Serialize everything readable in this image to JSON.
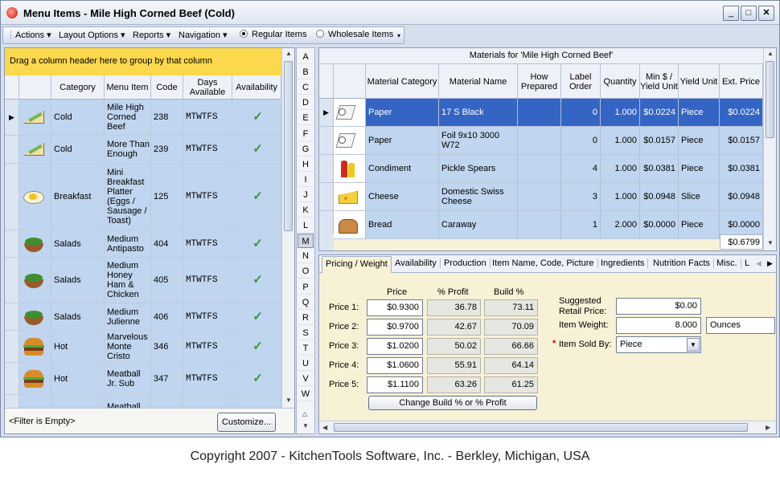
{
  "window": {
    "title": "Menu Items - Mile High Corned Beef (Cold)"
  },
  "toolbar": {
    "menus": [
      "Actions",
      "Layout Options",
      "Reports",
      "Navigation"
    ],
    "radio_regular": "Regular Items",
    "radio_wholesale": "Wholesale Items",
    "selected": "Regular Items"
  },
  "left": {
    "group_hint": "Drag a column header here to group by that column",
    "columns": [
      "Category",
      "Menu Item",
      "Code",
      "Days Available",
      "Availability"
    ],
    "rows": [
      {
        "icon": "sandwich-icon",
        "category": "Cold",
        "item": "Mile High Corned Beef",
        "code": "238",
        "days": "MTWTFS",
        "available": true
      },
      {
        "icon": "sandwich-icon",
        "category": "Cold",
        "item": "More Than Enough",
        "code": "239",
        "days": "MTWTFS",
        "available": true
      },
      {
        "icon": "egg-platter-icon",
        "category": "Breakfast",
        "item": "Mini Breakfast Platter (Eggs / Sausage / Toast)",
        "code": "125",
        "days": "MTWTFS",
        "available": true
      },
      {
        "icon": "salad-icon",
        "category": "Salads",
        "item": "Medium Antipasto",
        "code": "404",
        "days": "MTWTFS",
        "available": true
      },
      {
        "icon": "salad-icon",
        "category": "Salads",
        "item": "Medium Honey Ham & Chicken",
        "code": "405",
        "days": "MTWTFS",
        "available": true
      },
      {
        "icon": "salad-icon",
        "category": "Salads",
        "item": "Medium Julienne",
        "code": "406",
        "days": "MTWTFS",
        "available": true
      },
      {
        "icon": "burger-icon",
        "category": "Hot",
        "item": "Marvelous Monte Cristo",
        "code": "346",
        "days": "MTWTFS",
        "available": true
      },
      {
        "icon": "burger-icon",
        "category": "Hot",
        "item": "Meatball Jr. Sub",
        "code": "347",
        "days": "MTWTFS",
        "available": true
      },
      {
        "icon": "",
        "category": "",
        "item": "Meatball,",
        "code": "",
        "days": "",
        "available": false
      }
    ],
    "filter_text": "<Filter is Empty>",
    "customize_label": "Customize..."
  },
  "alphabet": [
    "A",
    "B",
    "C",
    "D",
    "E",
    "F",
    "G",
    "H",
    "I",
    "J",
    "K",
    "L",
    "M",
    "N",
    "O",
    "P",
    "Q",
    "R",
    "S",
    "T",
    "U",
    "V",
    "W"
  ],
  "alphabet_selected": "M",
  "materials": {
    "caption": "Materials for 'Mile High Corned Beef'",
    "columns": [
      "Material Category",
      "Material Name",
      "How Prepared",
      "Label Order",
      "Quantity",
      "Min $ / Yield Unit",
      "Yield Unit",
      "Ext. Price"
    ],
    "rows": [
      {
        "icon": "paper-roll-icon",
        "category": "Paper",
        "name": "17 S Black",
        "prepared": "",
        "order": "0",
        "qty": "1.000",
        "min": "$0.0224",
        "unit": "Piece",
        "ext": "$0.0224"
      },
      {
        "icon": "paper-roll-icon",
        "category": "Paper",
        "name": "Foil 9x10 3000 W72",
        "prepared": "",
        "order": "0",
        "qty": "1.000",
        "min": "$0.0157",
        "unit": "Piece",
        "ext": "$0.0157"
      },
      {
        "icon": "condiment-icon",
        "category": "Condiment",
        "name": "Pickle Spears",
        "prepared": "",
        "order": "4",
        "qty": "1.000",
        "min": "$0.0381",
        "unit": "Piece",
        "ext": "$0.0381"
      },
      {
        "icon": "cheese-icon",
        "category": "Cheese",
        "name": "Domestic Swiss Cheese",
        "prepared": "",
        "order": "3",
        "qty": "1.000",
        "min": "$0.0948",
        "unit": "Slice",
        "ext": "$0.0948"
      },
      {
        "icon": "bread-icon",
        "category": "Bread",
        "name": "Caraway",
        "prepared": "",
        "order": "1",
        "qty": "2.000",
        "min": "$0.0000",
        "unit": "Piece",
        "ext": "$0.0000"
      }
    ],
    "total": "$0.6799"
  },
  "tabs": [
    "Pricing / Weight",
    "Availability",
    "Production",
    "Item Name, Code, Picture",
    "Ingredients",
    "Nutrition Facts",
    "Misc.",
    "L"
  ],
  "pricing": {
    "headers": {
      "price": "Price",
      "profit": "% Profit",
      "build": "Build %"
    },
    "rows": [
      {
        "label": "Price 1:",
        "price": "$0.9300",
        "profit": "36.78",
        "build": "73.11"
      },
      {
        "label": "Price 2:",
        "price": "$0.9700",
        "profit": "42.67",
        "build": "70.09"
      },
      {
        "label": "Price 3:",
        "price": "$1.0200",
        "profit": "50.02",
        "build": "66.66"
      },
      {
        "label": "Price 4:",
        "price": "$1.0600",
        "profit": "55.91",
        "build": "64.14"
      },
      {
        "label": "Price 5:",
        "price": "$1.1100",
        "profit": "63.26",
        "build": "61.25"
      }
    ],
    "change_button": "Change Build % or % Profit",
    "suggested_label": "Suggested Retail Price:",
    "suggested_value": "$0.00",
    "weight_label": "Item Weight:",
    "weight_value": "8.000",
    "weight_unit": "Ounces",
    "sold_by_label": "Item Sold By:",
    "sold_by_value": "Piece"
  },
  "footer": {
    "copyright": "Copyright 2007 - KitchenTools Software, Inc. - Berkley, Michigan, USA"
  }
}
